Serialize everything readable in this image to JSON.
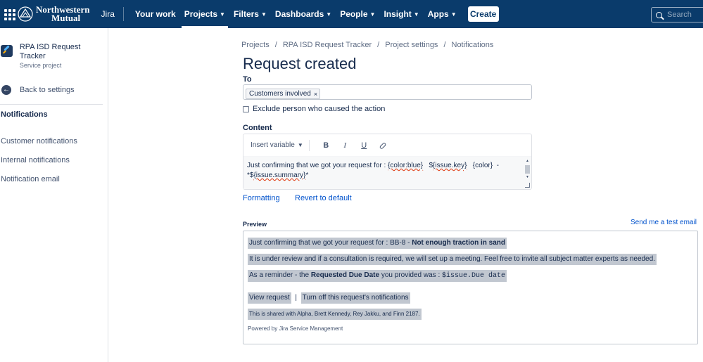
{
  "topnav": {
    "brand_line1": "Northwestern",
    "brand_line2": "Mutual",
    "product": "Jira",
    "items": [
      {
        "label": "Your work",
        "chev": false
      },
      {
        "label": "Projects",
        "chev": true
      },
      {
        "label": "Filters",
        "chev": true
      },
      {
        "label": "Dashboards",
        "chev": true
      },
      {
        "label": "People",
        "chev": true
      },
      {
        "label": "Insight",
        "chev": true
      },
      {
        "label": "Apps",
        "chev": true
      }
    ],
    "create_label": "Create",
    "search_placeholder": "Search",
    "bg_color": "#0a3b6b"
  },
  "sidebar": {
    "project_name": "RPA ISD Request Tracker",
    "project_type": "Service project",
    "back_label": "Back to settings",
    "section_title": "Notifications",
    "links": [
      "Customer notifications",
      "Internal notifications",
      "Notification email"
    ]
  },
  "breadcrumbs": [
    "Projects",
    "RPA ISD Request Tracker",
    "Project settings",
    "Notifications"
  ],
  "page_title": "Request created",
  "to": {
    "label": "To",
    "chip": "Customers involved",
    "chip_remove": "×"
  },
  "exclude_label": "Exclude person who caused the action",
  "content": {
    "label": "Content",
    "insert_variable": "Insert variable",
    "bold": "B",
    "italic": "I",
    "underline": "U",
    "body_part1": "Just confirming that we got your request  for : ",
    "body_color": "{color:blue}",
    "body_part2": "   $",
    "body_key": "{issue.key}",
    "body_part3": "   {color}  -",
    "body_part4": "*$",
    "body_summary": "{issue.summary}",
    "body_part5": "*"
  },
  "formatting_link": "Formatting",
  "revert_link": "Revert to default",
  "preview": {
    "label": "Preview",
    "send_test": "Send me a test email",
    "line1_a": "Just confirming that we got your request for : BB-8 - ",
    "line1_b": "Not enough traction in sand",
    "line2": "It is under review and if a consultation is required, we will set up a meeting. Feel free to invite all subject matter experts as needed.",
    "line3_a": "As a reminder - the ",
    "line3_b": "Requested Due Date",
    "line3_c": " you provided was : ",
    "line3_d": "$issue.Due date",
    "view_request": "View request",
    "pipe": "|",
    "turn_off": "Turn off this request's notifications",
    "shared": "This is shared with Alpha, Brett Kennedy, Rey Jakku, and Finn 2187.",
    "powered": "Powered by Jira Service Management"
  }
}
